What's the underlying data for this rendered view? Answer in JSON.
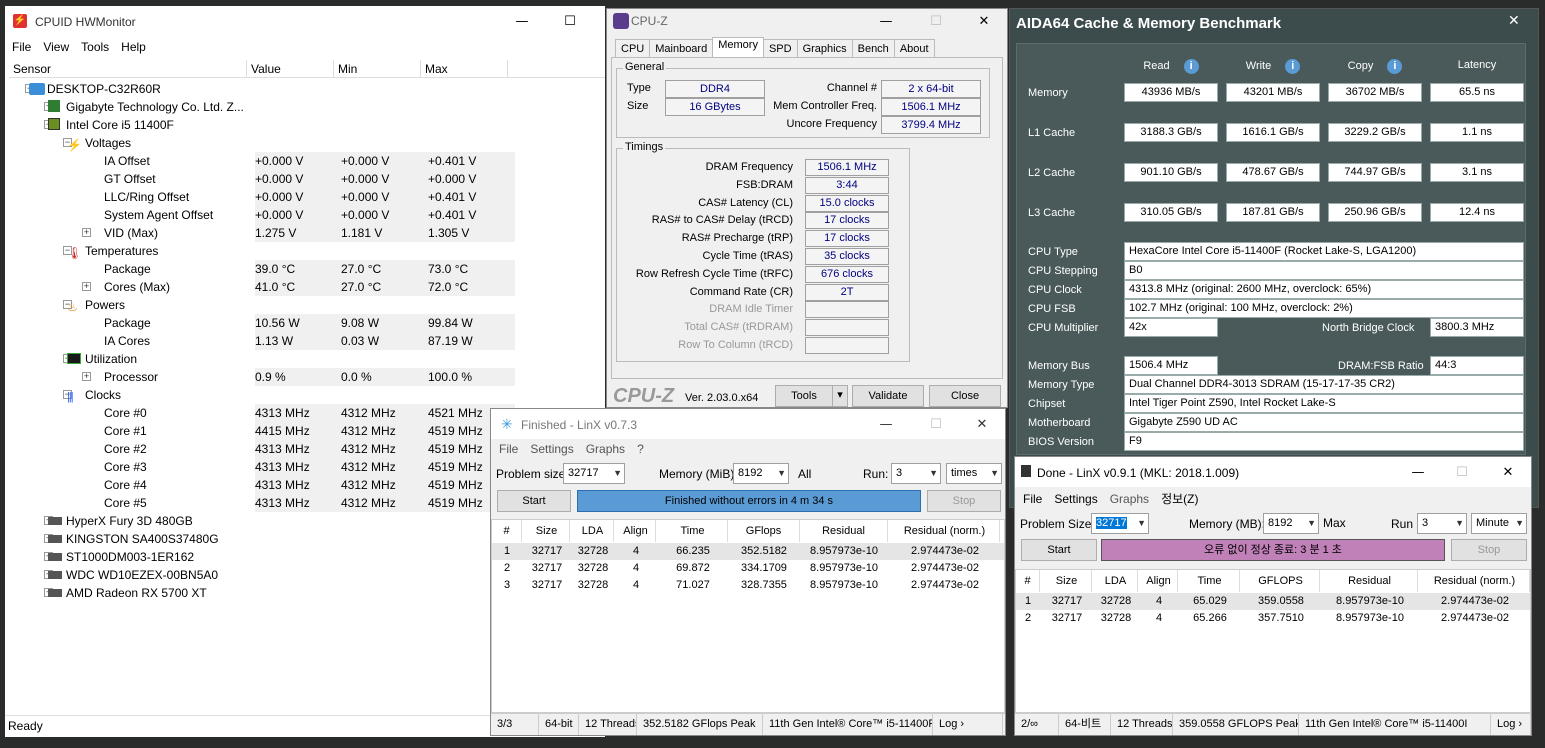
{
  "hwmonitor": {
    "title": "CPUID HWMonitor",
    "menu": [
      "File",
      "View",
      "Tools",
      "Help"
    ],
    "columns": [
      "Sensor",
      "Value",
      "Min",
      "Max"
    ],
    "status": "Ready",
    "root": "DESKTOP-C32R60R",
    "mobo": "Gigabyte Technology Co. Ltd. Z...",
    "cpu": "Intel Core i5 11400F",
    "voltages": "Voltages",
    "v_rows": [
      [
        "IA Offset",
        "+0.000 V",
        "+0.000 V",
        "+0.401 V"
      ],
      [
        "GT Offset",
        "+0.000 V",
        "+0.000 V",
        "+0.000 V"
      ],
      [
        "LLC/Ring Offset",
        "+0.000 V",
        "+0.000 V",
        "+0.401 V"
      ],
      [
        "System Agent Offset",
        "+0.000 V",
        "+0.000 V",
        "+0.401 V"
      ],
      [
        "VID (Max)",
        "1.275 V",
        "1.181 V",
        "1.305 V"
      ]
    ],
    "temps": "Temperatures",
    "t_rows": [
      [
        "Package",
        "39.0 °C",
        "27.0 °C",
        "73.0 °C"
      ],
      [
        "Cores (Max)",
        "41.0 °C",
        "27.0 °C",
        "72.0 °C"
      ]
    ],
    "powers": "Powers",
    "p_rows": [
      [
        "Package",
        "10.56 W",
        "9.08 W",
        "99.84 W"
      ],
      [
        "IA Cores",
        "1.13 W",
        "0.03 W",
        "87.19 W"
      ]
    ],
    "util": "Utilization",
    "u_rows": [
      [
        "Processor",
        "0.9 %",
        "0.0 %",
        "100.0 %"
      ]
    ],
    "clocks": "Clocks",
    "c_rows": [
      [
        "Core #0",
        "4313 MHz",
        "4312 MHz",
        "4521 MHz"
      ],
      [
        "Core #1",
        "4415 MHz",
        "4312 MHz",
        "4519 MHz"
      ],
      [
        "Core #2",
        "4313 MHz",
        "4312 MHz",
        "4519 MHz"
      ],
      [
        "Core #3",
        "4313 MHz",
        "4312 MHz",
        "4519 MHz"
      ],
      [
        "Core #4",
        "4313 MHz",
        "4312 MHz",
        "4519 MHz"
      ],
      [
        "Core #5",
        "4313 MHz",
        "4312 MHz",
        "4519 MHz"
      ]
    ],
    "devices": [
      "HyperX Fury 3D 480GB",
      "KINGSTON SA400S37480G",
      "ST1000DM003-1ER162",
      "WDC WD10EZEX-00BN5A0",
      "AMD Radeon RX 5700 XT"
    ]
  },
  "cpuz": {
    "title": "CPU-Z",
    "tabs": [
      "CPU",
      "Mainboard",
      "Memory",
      "SPD",
      "Graphics",
      "Bench",
      "About"
    ],
    "general": "General",
    "type_lbl": "Type",
    "type": "DDR4",
    "size_lbl": "Size",
    "size": "16 GBytes",
    "channel_lbl": "Channel #",
    "channel": "2 x 64-bit",
    "mcf_lbl": "Mem Controller Freq.",
    "mcf": "1506.1 MHz",
    "uncore_lbl": "Uncore Frequency",
    "uncore": "3799.4 MHz",
    "timings": "Timings",
    "t_rows": [
      [
        "DRAM Frequency",
        "1506.1 MHz"
      ],
      [
        "FSB:DRAM",
        "3:44"
      ],
      [
        "CAS# Latency (CL)",
        "15.0 clocks"
      ],
      [
        "RAS# to CAS# Delay (tRCD)",
        "17 clocks"
      ],
      [
        "RAS# Precharge (tRP)",
        "17 clocks"
      ],
      [
        "Cycle Time (tRAS)",
        "35 clocks"
      ],
      [
        "Row Refresh Cycle Time (tRFC)",
        "676 clocks"
      ],
      [
        "Command Rate (CR)",
        "2T"
      ],
      [
        "DRAM Idle Timer",
        ""
      ],
      [
        "Total CAS# (tRDRAM)",
        ""
      ],
      [
        "Row To Column (tRCD)",
        ""
      ]
    ],
    "logo": "CPU-Z",
    "version": "Ver. 2.03.0.x64",
    "tools": "Tools",
    "validate": "Validate",
    "close": "Close"
  },
  "aida": {
    "title": "AIDA64 Cache & Memory Benchmark",
    "cols": [
      "Read",
      "Write",
      "Copy",
      "Latency"
    ],
    "rows": [
      [
        "Memory",
        "43936 MB/s",
        "43201 MB/s",
        "36702 MB/s",
        "65.5 ns"
      ],
      [
        "L1 Cache",
        "3188.3 GB/s",
        "1616.1 GB/s",
        "3229.2 GB/s",
        "1.1 ns"
      ],
      [
        "L2 Cache",
        "901.10 GB/s",
        "478.67 GB/s",
        "744.97 GB/s",
        "3.1 ns"
      ],
      [
        "L3 Cache",
        "310.05 GB/s",
        "187.81 GB/s",
        "250.96 GB/s",
        "12.4 ns"
      ]
    ],
    "cpu_type_lbl": "CPU Type",
    "cpu_type": "HexaCore Intel Core i5-11400F  (Rocket Lake-S, LGA1200)",
    "stepping_lbl": "CPU Stepping",
    "stepping": "B0",
    "clock_lbl": "CPU Clock",
    "clock": "4313.8 MHz  (original: 2600 MHz, overclock: 65%)",
    "fsb_lbl": "CPU FSB",
    "fsb": "102.7 MHz  (original: 100 MHz, overclock: 2%)",
    "mult_lbl": "CPU Multiplier",
    "mult": "42x",
    "nb_lbl": "North Bridge Clock",
    "nb": "3800.3 MHz",
    "bus_lbl": "Memory Bus",
    "bus": "1506.4 MHz",
    "ratio_lbl": "DRAM:FSB Ratio",
    "ratio": "44:3",
    "memtype_lbl": "Memory Type",
    "memtype": "Dual Channel DDR4-3013 SDRAM  (15-17-17-35 CR2)",
    "chipset_lbl": "Chipset",
    "chipset": "Intel Tiger Point Z590, Intel Rocket Lake-S",
    "mb_lbl": "Motherboard",
    "mb": "Gigabyte Z590 UD AC",
    "bios_lbl": "BIOS Version",
    "bios": "F9"
  },
  "linx1": {
    "title": "Finished - LinX v0.7.3",
    "menu": [
      "File",
      "Settings",
      "Graphs",
      "?"
    ],
    "ps_lbl": "Problem size:",
    "ps": "32717",
    "mem_lbl": "Memory (MiB):",
    "mem": "8192",
    "all": "All",
    "run_lbl": "Run:",
    "run": "3",
    "unit": "times",
    "start": "Start",
    "progress": "Finished without errors in 4 m 34 s",
    "stop": "Stop",
    "cols": [
      "#",
      "Size",
      "LDA",
      "Align",
      "Time",
      "GFlops",
      "Residual",
      "Residual (norm.)"
    ],
    "rows": [
      [
        "1",
        "32717",
        "32728",
        "4",
        "66.235",
        "352.5182",
        "8.957973e-10",
        "2.974473e-02"
      ],
      [
        "2",
        "32717",
        "32728",
        "4",
        "69.872",
        "334.1709",
        "8.957973e-10",
        "2.974473e-02"
      ],
      [
        "3",
        "32717",
        "32728",
        "4",
        "71.027",
        "328.7355",
        "8.957973e-10",
        "2.974473e-02"
      ]
    ],
    "status": [
      "3/3",
      "64-bit",
      "12 Threads",
      "352.5182 GFlops Peak",
      "11th Gen Intel® Core™ i5-11400F",
      "Log ›"
    ]
  },
  "linx2": {
    "title": "Done - LinX v0.9.1 (MKL: 2018.1.009)",
    "menu": [
      "File",
      "Settings",
      "Graphs",
      "정보(Z)"
    ],
    "ps_lbl": "Problem Size:",
    "ps": "32717",
    "mem_lbl": "Memory (MB):",
    "mem": "8192",
    "max": "Max",
    "run_lbl": "Run",
    "run": "3",
    "unit": "Minute",
    "start": "Start",
    "progress": "오류 없이 정상 종료: 3 분 1 초",
    "stop": "Stop",
    "cols": [
      "#",
      "Size",
      "LDA",
      "Align",
      "Time",
      "GFLOPS",
      "Residual",
      "Residual (norm.)"
    ],
    "rows": [
      [
        "1",
        "32717",
        "32728",
        "4",
        "65.029",
        "359.0558",
        "8.957973e-10",
        "2.974473e-02"
      ],
      [
        "2",
        "32717",
        "32728",
        "4",
        "65.266",
        "357.7510",
        "8.957973e-10",
        "2.974473e-02"
      ]
    ],
    "status": [
      "2/∞",
      "64-비트",
      "12 ThreadsAl",
      "359.0558 GFLOPS Peak",
      "11th Gen Intel® Core™ i5-11400I",
      "Log ›"
    ]
  },
  "colors": {
    "progress1": "#5b9bd5",
    "progress2": "#c080b8",
    "aida_bg": "#3c4c4c"
  }
}
